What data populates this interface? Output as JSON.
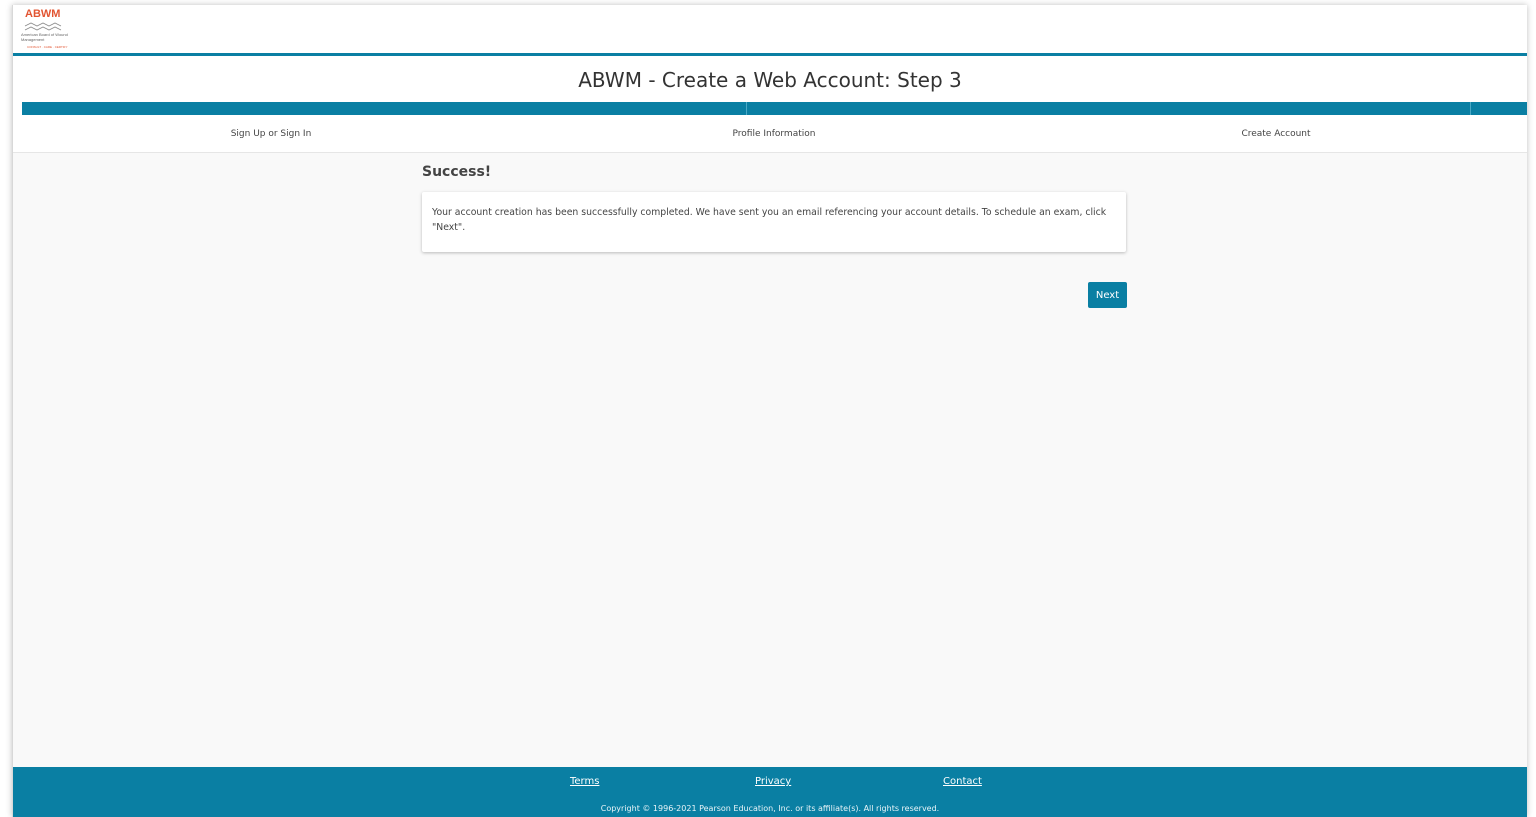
{
  "header": {
    "logo": {
      "text": "ABWM",
      "subtitle": "American Board of Wound Management",
      "tagline": "CONSULT · CARE · CERTIFY"
    }
  },
  "page": {
    "title": "ABWM - Create a Web Account: Step 3"
  },
  "progress": {
    "steps": [
      {
        "label": "Sign Up or Sign In"
      },
      {
        "label": "Profile Information"
      },
      {
        "label": "Create Account"
      }
    ],
    "current_step": 3,
    "total_steps": 3
  },
  "main": {
    "heading": "Success!",
    "message": "Your account creation has been successfully completed. We have sent you an email referencing your account details. To schedule an exam, click \"Next\".",
    "next_label": "Next"
  },
  "footer": {
    "links": [
      {
        "label": "Terms"
      },
      {
        "label": "Privacy"
      },
      {
        "label": "Contact"
      }
    ],
    "copyright": "Copyright © 1996-2021 Pearson Education, Inc. or its affiliate(s). All rights reserved."
  },
  "colors": {
    "accent": "#0a7fa3",
    "brand_logo": "#e25532",
    "background": "#f9f9f9"
  }
}
